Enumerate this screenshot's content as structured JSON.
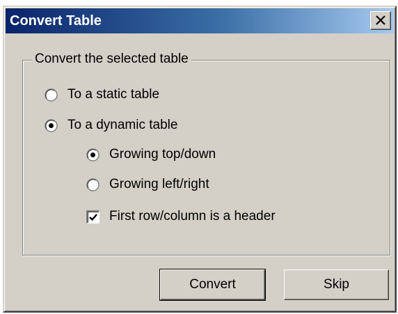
{
  "dialog": {
    "title": "Convert Table",
    "close_glyph": "✕"
  },
  "group": {
    "label": "Convert the selected table"
  },
  "options": {
    "static": {
      "label": "To a static table",
      "selected": false
    },
    "dynamic": {
      "label": "To a dynamic table",
      "selected": true
    },
    "growing_top_down": {
      "label": "Growing top/down",
      "selected": true
    },
    "growing_left_right": {
      "label": "Growing left/right",
      "selected": false
    },
    "header": {
      "label": "First row/column is a header",
      "checked": true
    }
  },
  "buttons": {
    "convert": "Convert",
    "skip": "Skip"
  },
  "colors": {
    "face": "#d4d0c8",
    "title_start": "#0a246a",
    "title_end": "#a6caf0"
  }
}
